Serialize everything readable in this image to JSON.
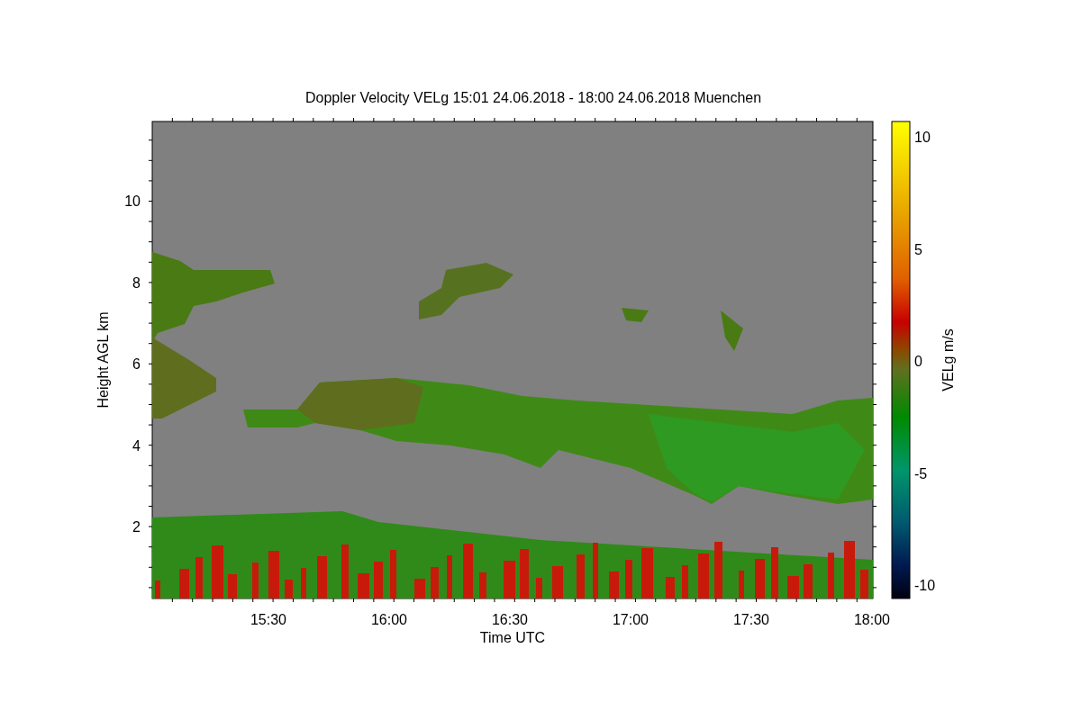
{
  "title": "Doppler Velocity VELg   15:01 24.06.2018 - 18:00 24.06.2018 Muenchen",
  "x_axis": {
    "label": "Time UTC",
    "ticks": [
      "15:30",
      "16:00",
      "16:30",
      "17:00",
      "17:30",
      "18:00"
    ]
  },
  "y_axis": {
    "label": "Height AGL km",
    "ticks": [
      "10",
      "8",
      "6",
      "4",
      "2"
    ]
  },
  "colorbar": {
    "label": "VELg m/s",
    "ticks": [
      "10",
      "5",
      "0",
      "-5",
      "-10"
    ]
  }
}
